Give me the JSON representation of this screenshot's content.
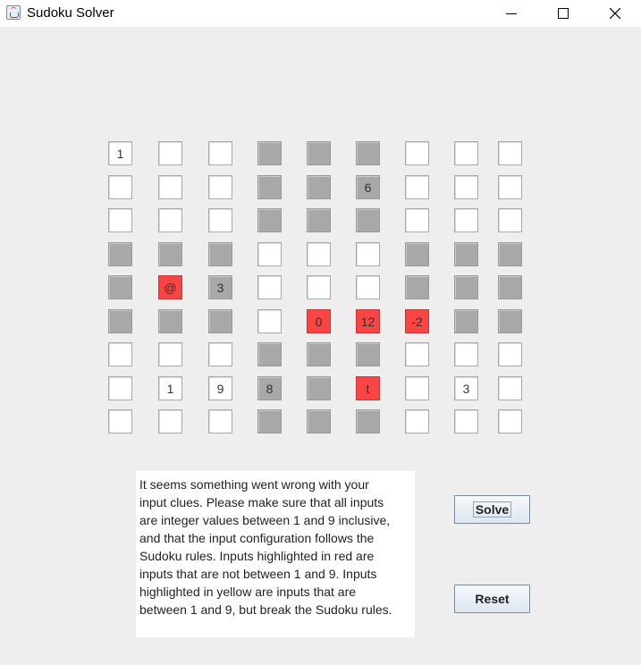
{
  "window": {
    "title": "Sudoku Solver",
    "app_icon": "java-cup-icon",
    "controls": [
      "minimize-icon",
      "maximize-icon",
      "close-icon"
    ]
  },
  "grid": {
    "colors": {
      "white": "#ffffff",
      "gray": "#a8a8a8",
      "invalid_red": "#fb4444",
      "invalid_yellow": "#ffff00"
    },
    "rows": [
      [
        {
          "v": "1",
          "c": "white"
        },
        {
          "v": "",
          "c": "white"
        },
        {
          "v": "",
          "c": "white"
        },
        {
          "v": "",
          "c": "gray"
        },
        {
          "v": "",
          "c": "gray"
        },
        {
          "v": "",
          "c": "gray"
        },
        {
          "v": "",
          "c": "white"
        },
        {
          "v": "",
          "c": "white"
        },
        {
          "v": "",
          "c": "white"
        }
      ],
      [
        {
          "v": "",
          "c": "white"
        },
        {
          "v": "",
          "c": "white"
        },
        {
          "v": "",
          "c": "white"
        },
        {
          "v": "",
          "c": "gray"
        },
        {
          "v": "",
          "c": "gray"
        },
        {
          "v": "6",
          "c": "gray"
        },
        {
          "v": "",
          "c": "white"
        },
        {
          "v": "",
          "c": "white"
        },
        {
          "v": "",
          "c": "white"
        }
      ],
      [
        {
          "v": "",
          "c": "white"
        },
        {
          "v": "",
          "c": "white"
        },
        {
          "v": "",
          "c": "white"
        },
        {
          "v": "",
          "c": "gray"
        },
        {
          "v": "",
          "c": "gray"
        },
        {
          "v": "",
          "c": "gray"
        },
        {
          "v": "",
          "c": "white"
        },
        {
          "v": "",
          "c": "white"
        },
        {
          "v": "",
          "c": "white"
        }
      ],
      [
        {
          "v": "",
          "c": "gray"
        },
        {
          "v": "",
          "c": "gray"
        },
        {
          "v": "",
          "c": "gray"
        },
        {
          "v": "",
          "c": "white"
        },
        {
          "v": "",
          "c": "white"
        },
        {
          "v": "",
          "c": "white"
        },
        {
          "v": "",
          "c": "gray"
        },
        {
          "v": "",
          "c": "gray"
        },
        {
          "v": "",
          "c": "gray"
        }
      ],
      [
        {
          "v": "",
          "c": "gray"
        },
        {
          "v": "@",
          "c": "red"
        },
        {
          "v": "3",
          "c": "gray"
        },
        {
          "v": "",
          "c": "white"
        },
        {
          "v": "",
          "c": "white"
        },
        {
          "v": "",
          "c": "white"
        },
        {
          "v": "",
          "c": "gray"
        },
        {
          "v": "",
          "c": "gray"
        },
        {
          "v": "",
          "c": "gray"
        }
      ],
      [
        {
          "v": "",
          "c": "gray"
        },
        {
          "v": "",
          "c": "gray"
        },
        {
          "v": "",
          "c": "gray"
        },
        {
          "v": "",
          "c": "white"
        },
        {
          "v": "0",
          "c": "red"
        },
        {
          "v": "12",
          "c": "red"
        },
        {
          "v": "-2",
          "c": "red"
        },
        {
          "v": "",
          "c": "gray"
        },
        {
          "v": "",
          "c": "gray"
        }
      ],
      [
        {
          "v": "",
          "c": "white"
        },
        {
          "v": "",
          "c": "white"
        },
        {
          "v": "",
          "c": "white"
        },
        {
          "v": "",
          "c": "gray"
        },
        {
          "v": "",
          "c": "gray"
        },
        {
          "v": "",
          "c": "gray"
        },
        {
          "v": "",
          "c": "white"
        },
        {
          "v": "",
          "c": "white"
        },
        {
          "v": "",
          "c": "white"
        }
      ],
      [
        {
          "v": "",
          "c": "white"
        },
        {
          "v": "1",
          "c": "white"
        },
        {
          "v": "9",
          "c": "white"
        },
        {
          "v": "8",
          "c": "gray"
        },
        {
          "v": "",
          "c": "gray"
        },
        {
          "v": "t",
          "c": "red"
        },
        {
          "v": "",
          "c": "white"
        },
        {
          "v": "3",
          "c": "white"
        },
        {
          "v": "",
          "c": "white"
        }
      ],
      [
        {
          "v": "",
          "c": "white"
        },
        {
          "v": "",
          "c": "white"
        },
        {
          "v": "",
          "c": "white"
        },
        {
          "v": "",
          "c": "gray"
        },
        {
          "v": "",
          "c": "gray"
        },
        {
          "v": "",
          "c": "gray"
        },
        {
          "v": "",
          "c": "white"
        },
        {
          "v": "",
          "c": "white"
        },
        {
          "v": "",
          "c": "white"
        }
      ]
    ]
  },
  "message": {
    "text": "It seems something went wrong with your\ninput clues. Please make sure that all inputs\nare integer values between 1 and 9 inclusive,\nand that the input configuration follows the\nSudoku rules. Inputs highlighted in red are\ninputs that are not between 1 and 9. Inputs\nhighlighted in yellow are inputs that are\nbetween 1 and 9, but break the Sudoku rules."
  },
  "buttons": {
    "solve_label": "Solve",
    "reset_label": "Reset"
  }
}
